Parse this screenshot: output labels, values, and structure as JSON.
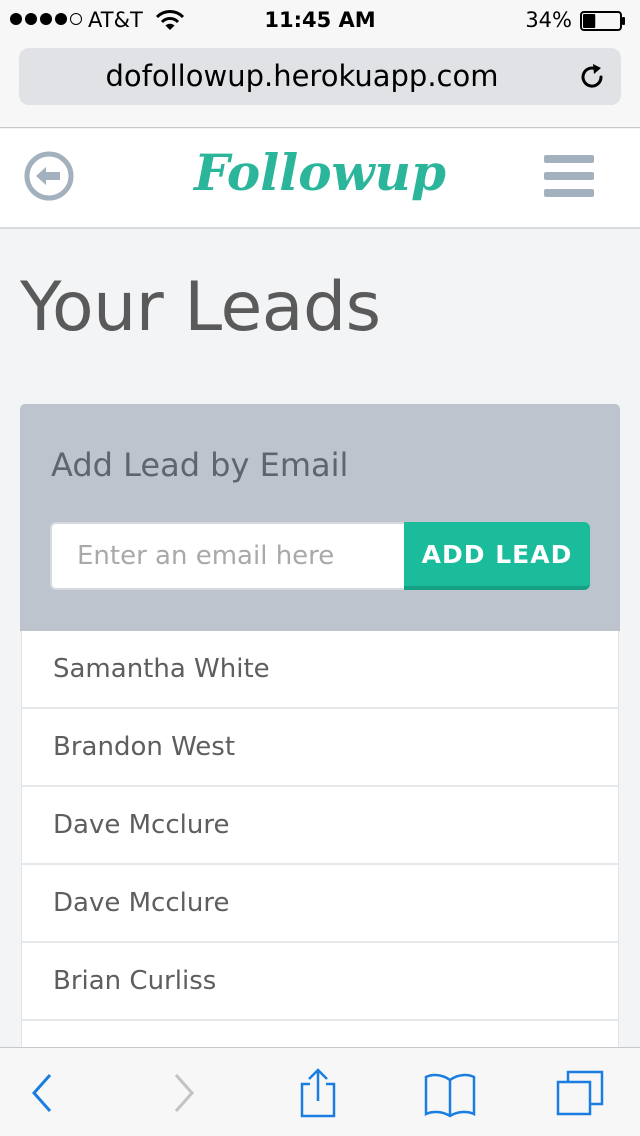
{
  "status_bar": {
    "carrier": "AT&T",
    "time": "11:45 AM",
    "battery_percent": "34%",
    "battery_level": 0.34,
    "signal_bars_filled": 4,
    "signal_bars_total": 5
  },
  "browser": {
    "url": "dofollowup.herokuapp.com",
    "icons": {
      "reload": "reload-icon",
      "back": "chevron-left-icon",
      "forward": "chevron-right-icon",
      "share": "share-icon",
      "bookmarks": "book-icon",
      "tabs": "tabs-icon"
    }
  },
  "header": {
    "brand": "Followup",
    "brand_color": "#2bb59b",
    "back_icon": "back-arrow-circle-icon",
    "menu_icon": "hamburger-menu-icon"
  },
  "page": {
    "title": "Your Leads"
  },
  "add_lead": {
    "title": "Add Lead by Email",
    "placeholder": "Enter an email here",
    "value": "",
    "button_label": "ADD LEAD",
    "accent_color": "#1abc9c"
  },
  "leads": [
    {
      "name": "Samantha White"
    },
    {
      "name": "Brandon West"
    },
    {
      "name": "Dave Mcclure"
    },
    {
      "name": "Dave Mcclure"
    },
    {
      "name": "Brian Curliss"
    },
    {
      "name": ""
    }
  ]
}
